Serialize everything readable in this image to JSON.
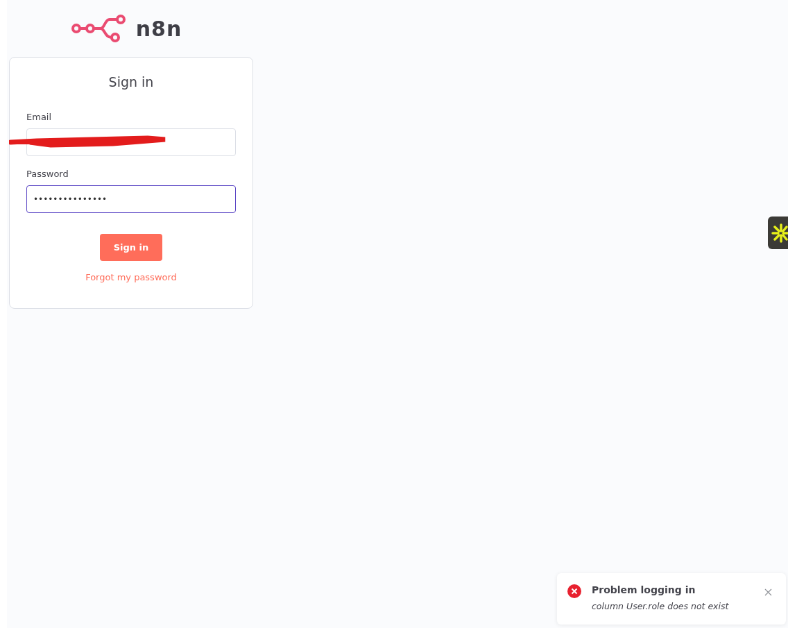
{
  "logo": {
    "text": "n8n"
  },
  "form": {
    "title": "Sign in",
    "fields": [
      {
        "label": "Email",
        "kind": "redacted",
        "focused": false
      },
      {
        "label": "Password",
        "kind": "password",
        "value": "•••••••••••••••",
        "focused": true
      }
    ],
    "submit": "Sign in",
    "forgot_link": "Forgot my password"
  },
  "toast": {
    "title": "Problem logging in",
    "message": "column User.role does not exist"
  }
}
